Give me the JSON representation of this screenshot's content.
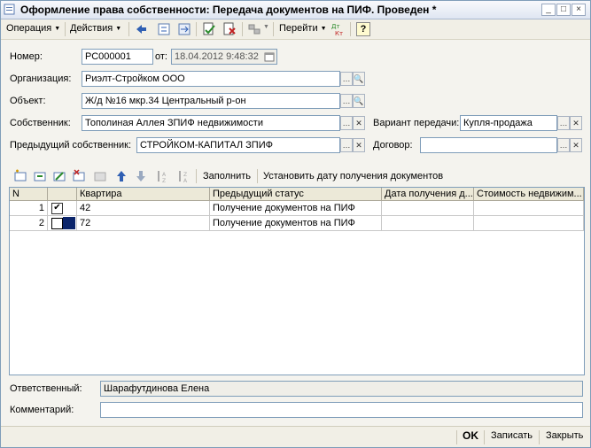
{
  "window": {
    "title": "Оформление права собственности: Передача документов на ПИФ. Проведен *",
    "minimize": "_",
    "maximize": "□",
    "close": "×"
  },
  "toolbar": {
    "operation": "Операция",
    "actions": "Действия",
    "goto": "Перейти",
    "help": "?"
  },
  "form": {
    "number_label": "Номер:",
    "number_value": "РС000001",
    "date_label": "от:",
    "date_value": "18.04.2012 9:48:32",
    "org_label": "Организация:",
    "org_value": "Риэлт-Стройком ООО",
    "object_label": "Объект:",
    "object_value": "Ж/д №16 мкр.34 Центральный р-он",
    "owner_label": "Собственник:",
    "owner_value": "Тополиная Аллея ЗПИФ недвижимости",
    "transfer_label": "Вариант передачи:",
    "transfer_value": "Купля-продажа",
    "prev_owner_label": "Предыдущий собственник:",
    "prev_owner_value": "СТРОЙКОМ-КАПИТАЛ ЗПИФ",
    "contract_label": "Договор:",
    "contract_value": "",
    "responsible_label": "Ответственный:",
    "responsible_value": "Шарафутдинова Елена",
    "comment_label": "Комментарий:",
    "comment_value": ""
  },
  "table_toolbar": {
    "fill": "Заполнить",
    "set_date": "Установить дату получения документов"
  },
  "table": {
    "headers": [
      "N",
      "",
      "Квартира",
      "Предыдущий статус",
      "Дата получения д...",
      "Стоимость недвижим..."
    ],
    "rows": [
      {
        "n": "1",
        "checked": true,
        "apt": "42",
        "status": "Получение документов на ПИФ",
        "date": "",
        "cost": ""
      },
      {
        "n": "2",
        "checked": false,
        "apt": "72",
        "status": "Получение документов на ПИФ",
        "date": "",
        "cost": ""
      }
    ]
  },
  "buttons": {
    "ok": "OK",
    "save": "Записать",
    "close": "Закрыть"
  }
}
